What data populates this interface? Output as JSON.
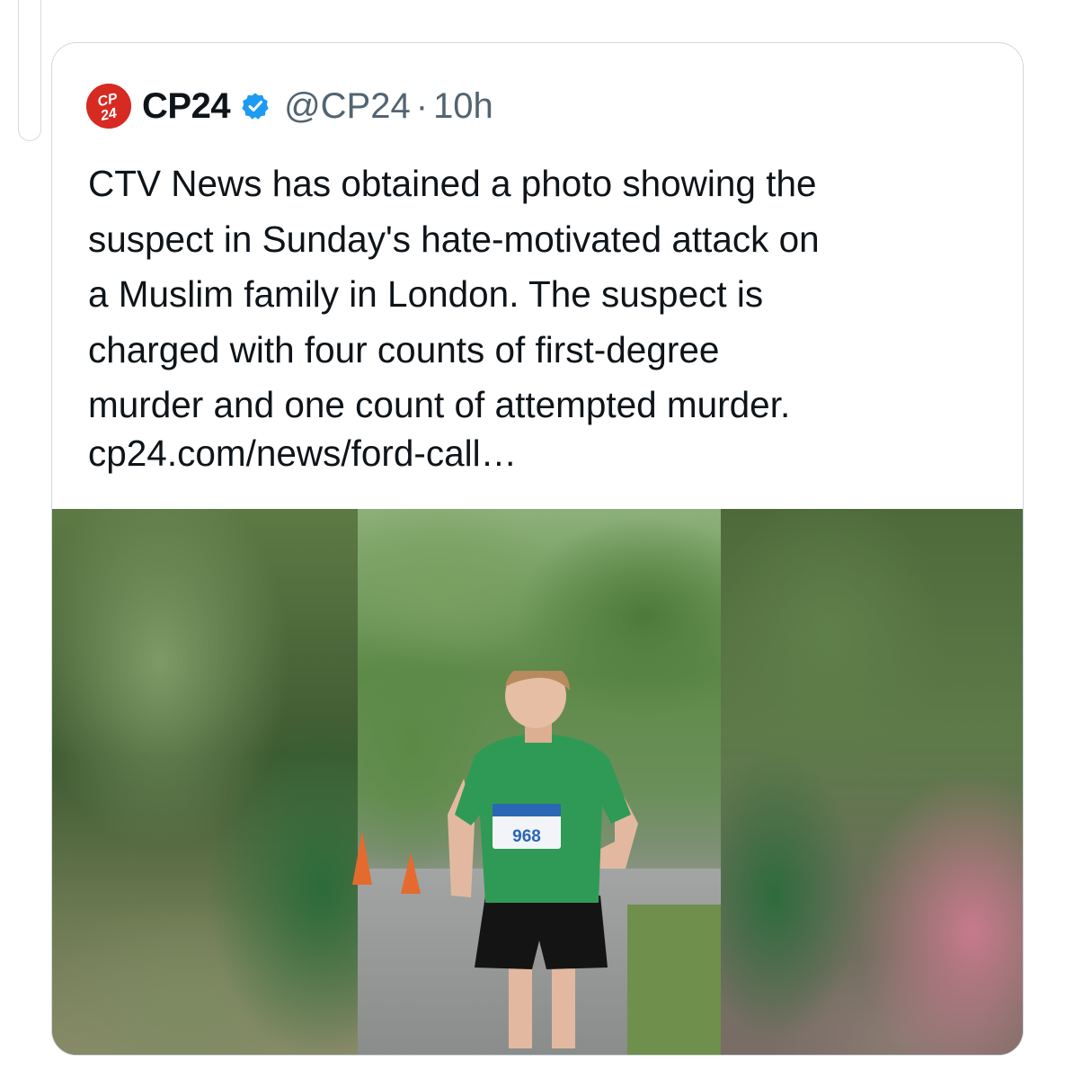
{
  "tweet": {
    "display_name": "CP24",
    "verified_label": "verified",
    "handle": "@CP24",
    "separator": "·",
    "time": "10h",
    "logo_text": "CP24",
    "text": "CTV News has obtained a photo showing the\nsuspect in Sunday's hate-motivated attack on\na Muslim family in London. The suspect is\ncharged with four counts of first-degree\nmurder and one count of attempted murder.",
    "link": "cp24.com/news/ford-call…"
  },
  "media": {
    "bib_number": "968"
  },
  "colors": {
    "brand_red": "#d72a22",
    "verified_blue": "#1d9bf0",
    "text": "#0f1419",
    "muted": "#536471",
    "border": "#cfd9de"
  },
  "icons": [
    "cp24-logo-icon",
    "verified-badge-icon"
  ]
}
